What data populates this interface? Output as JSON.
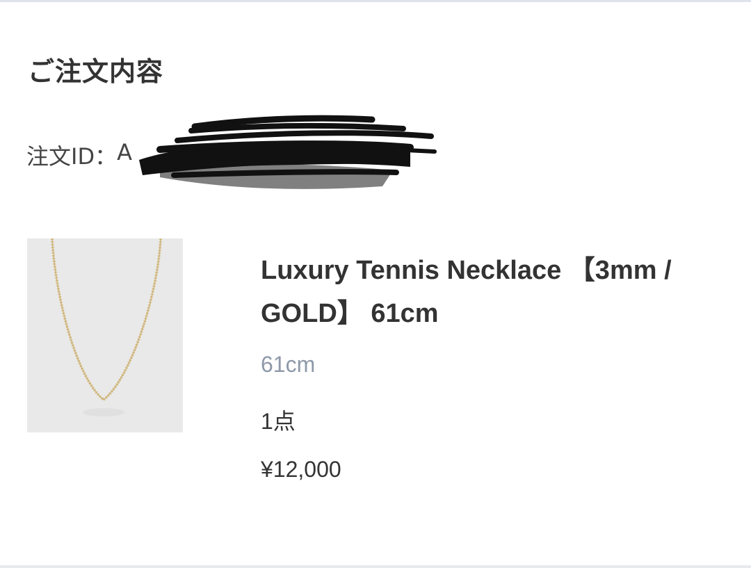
{
  "order": {
    "section_title": "ご注文内容",
    "order_id_label": "注文ID：",
    "order_id_visible": "A"
  },
  "item": {
    "image_icon": "necklace-image",
    "name": "Luxury Tennis Necklace 【3mm / GOLD】 61cm",
    "variant": "61cm",
    "quantity": "1点",
    "price": "¥12,000"
  },
  "colors": {
    "text": "#333333",
    "muted": "#8e99a8",
    "image_bg": "#e9e9e9",
    "chain_gold": "#d8c08a"
  }
}
